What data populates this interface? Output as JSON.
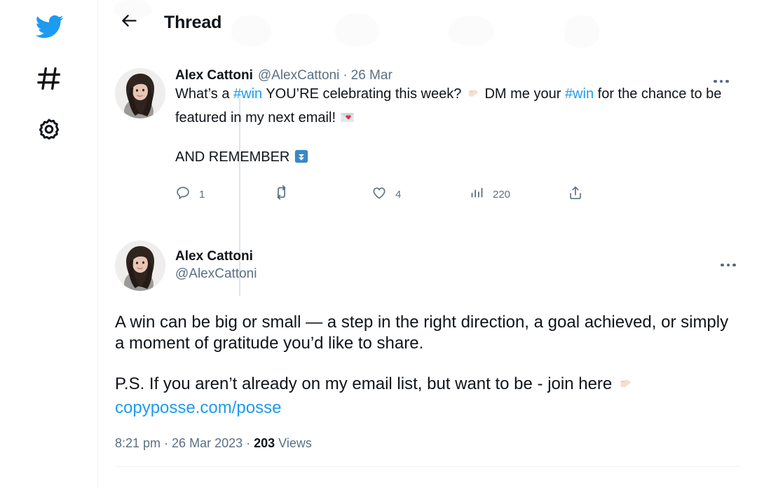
{
  "sidebar": {
    "items": [
      {
        "icon": "twitter-bird-icon",
        "label": "Twitter",
        "color": "#1d9bf0"
      },
      {
        "icon": "hashtag-icon",
        "label": "Explore",
        "color": "#0f1419"
      },
      {
        "icon": "gear-icon",
        "label": "Settings",
        "color": "#0f1419"
      }
    ]
  },
  "header": {
    "back_label": "Back",
    "title": "Thread"
  },
  "colors": {
    "accent": "#1d9bf0",
    "text": "#0f1419",
    "muted": "#5b7083",
    "line": "#dfe6ea",
    "divider": "#eff3f4"
  },
  "tweets": [
    {
      "author_name": "Alex Cattoni",
      "author_handle": "@AlexCattoni",
      "separator": "·",
      "date": "26 Mar",
      "more_label": "More",
      "text_parts": [
        {
          "type": "text",
          "value": "What’s a "
        },
        {
          "type": "hashtag",
          "value": "#win"
        },
        {
          "type": "text",
          "value": " YOU’RE celebrating this week? "
        },
        {
          "type": "emoji",
          "value": "👉",
          "name": "pointing-right-emoji"
        },
        {
          "type": "text",
          "value": " DM me your "
        },
        {
          "type": "hashtag",
          "value": "#win"
        },
        {
          "type": "text",
          "value": " for the chance to be featured in my next email! "
        },
        {
          "type": "emoji",
          "value": "💌",
          "name": "love-letter-emoji"
        }
      ],
      "line1": "What’s a #win YOU’RE celebrating this week? 👉 DM me your #win for the chance to be featured in my next email! 💌",
      "line2": "AND REMEMBER ⏬",
      "line2_label": "AND REMEMBER",
      "actions": {
        "reply": {
          "name": "reply-icon",
          "count": "1"
        },
        "retweet": {
          "name": "retweet-icon",
          "count": ""
        },
        "like": {
          "name": "like-icon",
          "count": "4"
        },
        "views": {
          "name": "analytics-icon",
          "count": "220"
        },
        "share": {
          "name": "share-icon",
          "count": ""
        }
      }
    },
    {
      "author_name": "Alex Cattoni",
      "author_handle": "@AlexCattoni",
      "more_label": "More",
      "paragraph1": "A win can be big or small — a step in the right direction, a goal achieved, or simply a moment of gratitude you’d like to share.",
      "ps_prefix": "P.S. If you aren’t already on my email list, but want to be - join here ",
      "ps_emoji": "👉",
      "link": "copyposse.com/posse",
      "meta_time": "8:21 pm",
      "meta_sep1": " · ",
      "meta_date": "26 Mar 2023",
      "meta_sep2": " · ",
      "meta_views_count": "203",
      "meta_views_label": " Views"
    }
  ]
}
